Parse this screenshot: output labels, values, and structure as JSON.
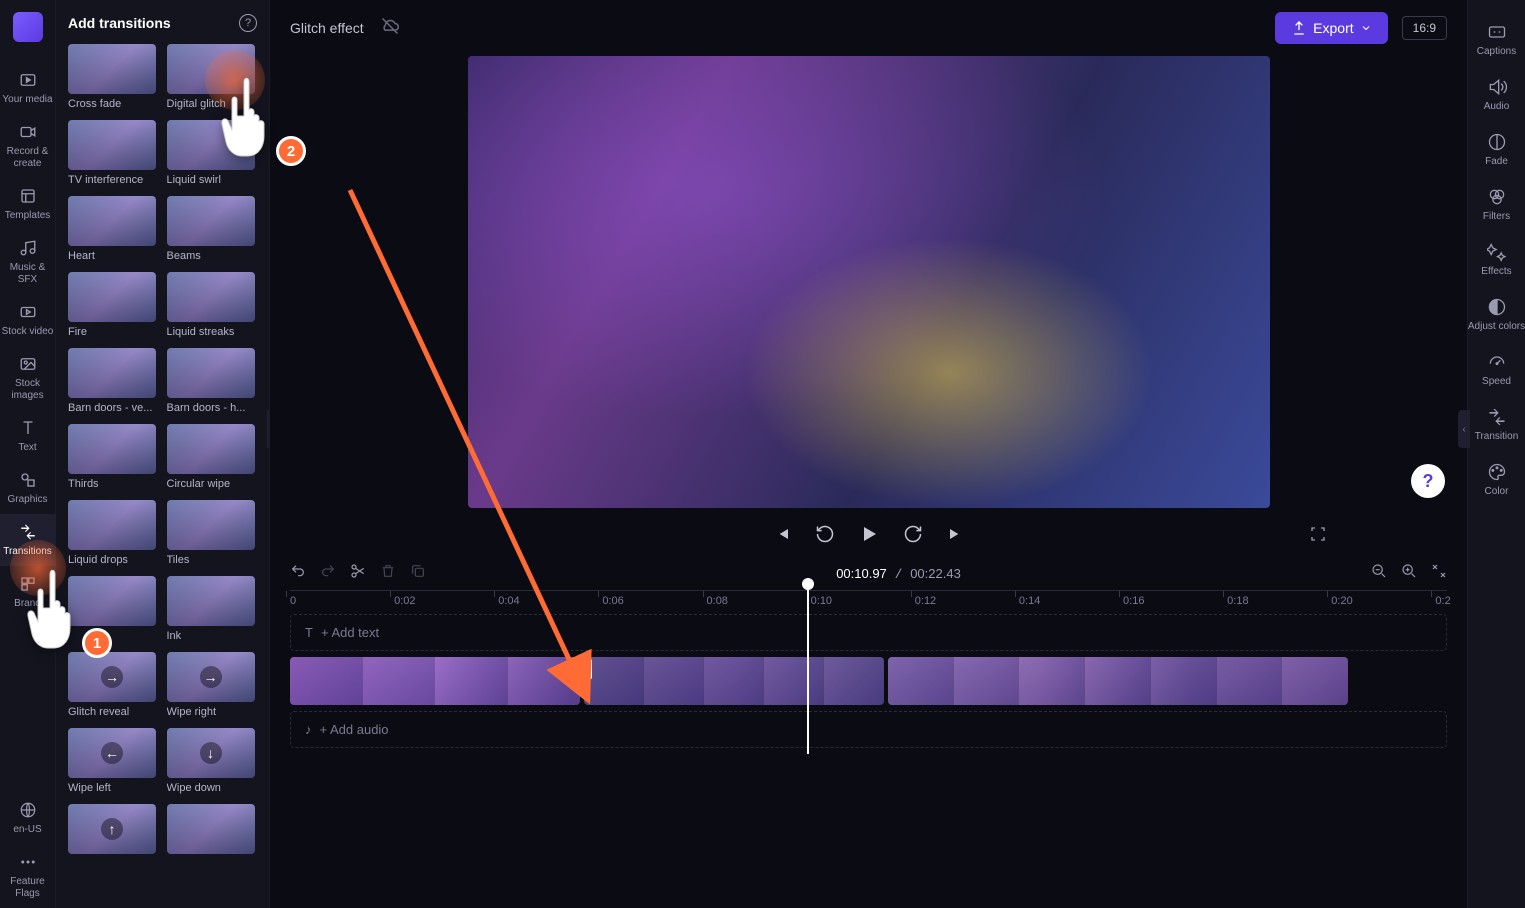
{
  "left_rail": {
    "items": [
      {
        "label": "Your media"
      },
      {
        "label": "Record & create"
      },
      {
        "label": "Templates"
      },
      {
        "label": "Music & SFX"
      },
      {
        "label": "Stock video"
      },
      {
        "label": "Stock images"
      },
      {
        "label": "Text"
      },
      {
        "label": "Graphics"
      },
      {
        "label": "Transitions"
      },
      {
        "label": "Brand"
      }
    ],
    "bottom": [
      {
        "label": "en-US"
      },
      {
        "label": "Feature Flags"
      }
    ]
  },
  "panel": {
    "title": "Add transitions",
    "items": [
      "Cross fade",
      "Digital glitch",
      "TV interference",
      "Liquid swirl",
      "Heart",
      "Beams",
      "Fire",
      "Liquid streaks",
      "Barn doors - ve...",
      "Barn doors - h...",
      "Thirds",
      "Circular wipe",
      "Liquid drops",
      "Tiles",
      "",
      "Ink",
      "Glitch reveal",
      "Wipe right",
      "Wipe left",
      "Wipe down",
      "",
      ""
    ]
  },
  "project": {
    "title": "Glitch effect"
  },
  "export_label": "Export",
  "aspect_ratio": "16:9",
  "playback": {
    "current": "00:10.97",
    "total": "00:22.43"
  },
  "ruler_ticks": [
    "0",
    "0:02",
    "0:04",
    "0:06",
    "0:08",
    "0:10",
    "0:12",
    "0:14",
    "0:16",
    "0:18",
    "0:20",
    "0:2"
  ],
  "tracks": {
    "text_placeholder": "+ Add text",
    "audio_placeholder": "+ Add audio"
  },
  "right_rail": {
    "items": [
      "Captions",
      "Audio",
      "Fade",
      "Filters",
      "Effects",
      "Adjust colors",
      "Speed",
      "Transition",
      "Color"
    ]
  },
  "annotations": {
    "step1": "1",
    "step2": "2"
  }
}
